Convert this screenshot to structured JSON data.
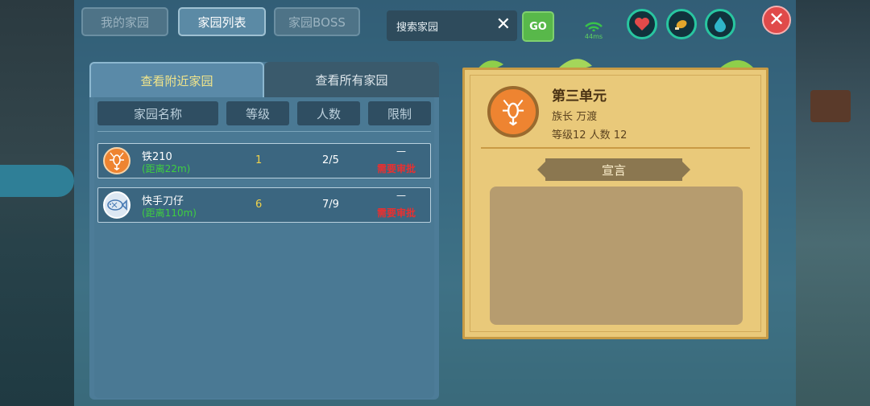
{
  "top_tabs": [
    {
      "label": "我的家园",
      "active": false
    },
    {
      "label": "家园列表",
      "active": true
    },
    {
      "label": "家园BOSS",
      "active": false
    }
  ],
  "search": {
    "value": "搜索家园",
    "clear_icon": "close-icon",
    "go_label": "GO"
  },
  "status": {
    "ping": "44ms"
  },
  "sub_tabs": [
    {
      "label": "查看附近家园",
      "active": true
    },
    {
      "label": "查看所有家园",
      "active": false
    }
  ],
  "columns": [
    "家园名称",
    "等级",
    "人数",
    "限制"
  ],
  "rows": [
    {
      "icon": "scorpion-icon",
      "name": "铁210",
      "distance": "(距离22m)",
      "level": "1",
      "members": "2/5",
      "limit_top": "—",
      "limit": "需要审批"
    },
    {
      "icon": "fish-icon",
      "name": "快手刀仔",
      "distance": "(距离110m)",
      "level": "6",
      "members": "7/9",
      "limit_top": "—",
      "limit": "需要审批"
    }
  ],
  "detail": {
    "name": "第三单元",
    "leader": "族长  万渡",
    "stats": "等级12    人数 12",
    "declaration_title": "宣言",
    "declaration": ""
  },
  "colors": {
    "accent_green": "#58b84a",
    "limit_red": "#e83030",
    "level_gold": "#f0d24a",
    "card_bg": "#e9c97a"
  }
}
